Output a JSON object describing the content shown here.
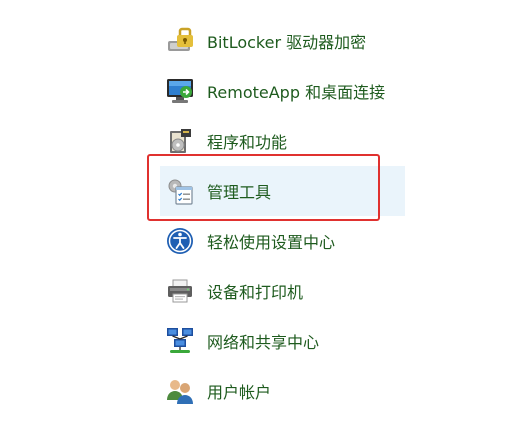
{
  "accent_color": "#e0312f",
  "link_color": "#1e5b1e",
  "hover_color": "#eaf4fb",
  "items": [
    {
      "label": "BitLocker 驱动器加密",
      "icon": "bitlocker-icon"
    },
    {
      "label": "RemoteApp 和桌面连接",
      "icon": "remote-desktop-icon"
    },
    {
      "label": "程序和功能",
      "icon": "programs-icon"
    },
    {
      "label": "管理工具",
      "icon": "admin-tools-icon"
    },
    {
      "label": "轻松使用设置中心",
      "icon": "ease-of-access-icon"
    },
    {
      "label": "设备和打印机",
      "icon": "printer-icon"
    },
    {
      "label": "网络和共享中心",
      "icon": "network-icon"
    },
    {
      "label": "用户帐户",
      "icon": "users-icon"
    }
  ]
}
